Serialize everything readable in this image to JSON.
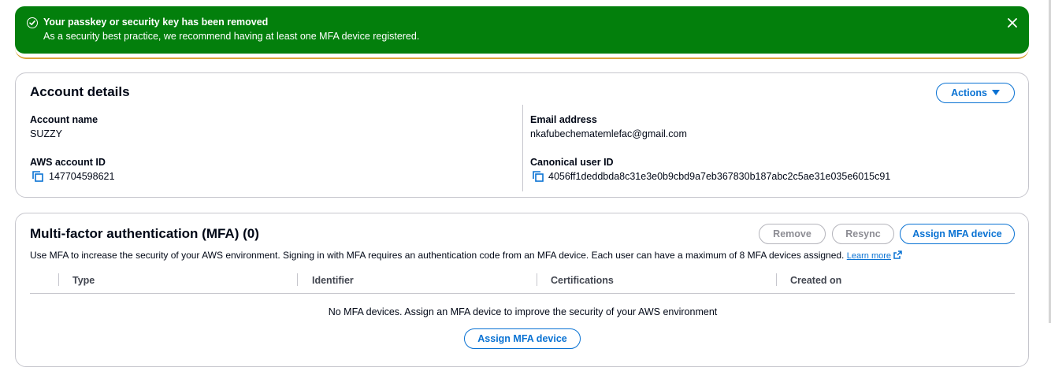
{
  "flash": {
    "title": "Your passkey or security key has been removed",
    "message": "As a security best practice, we recommend having at least one MFA device registered.",
    "color": "#037f0c"
  },
  "account": {
    "title": "Account details",
    "actions_label": "Actions",
    "account_name_label": "Account name",
    "account_name": "SUZZY",
    "account_id_label": "AWS account ID",
    "account_id": "147704598621",
    "email_label": "Email address",
    "email": "nkafubechematemlefac@gmail.com",
    "canonical_label": "Canonical user ID",
    "canonical_id": "4056ff1deddbda8c31e3e0b9cbd9a7eb367830b187abc2c5ae31e035e6015c91"
  },
  "mfa": {
    "title": "Multi-factor authentication (MFA) (0)",
    "remove_label": "Remove",
    "resync_label": "Resync",
    "assign_label": "Assign MFA device",
    "description": "Use MFA to increase the security of your AWS environment. Signing in with MFA requires an authentication code from an MFA device. Each user can have a maximum of 8 MFA devices assigned.",
    "learn_more": "Learn more",
    "columns": [
      "Type",
      "Identifier",
      "Certifications",
      "Created on"
    ],
    "empty_message": "No MFA devices. Assign an MFA device to improve the security of your AWS environment",
    "empty_assign_label": "Assign MFA device"
  },
  "colors": {
    "accent": "#0972d3",
    "success": "#037f0c"
  }
}
